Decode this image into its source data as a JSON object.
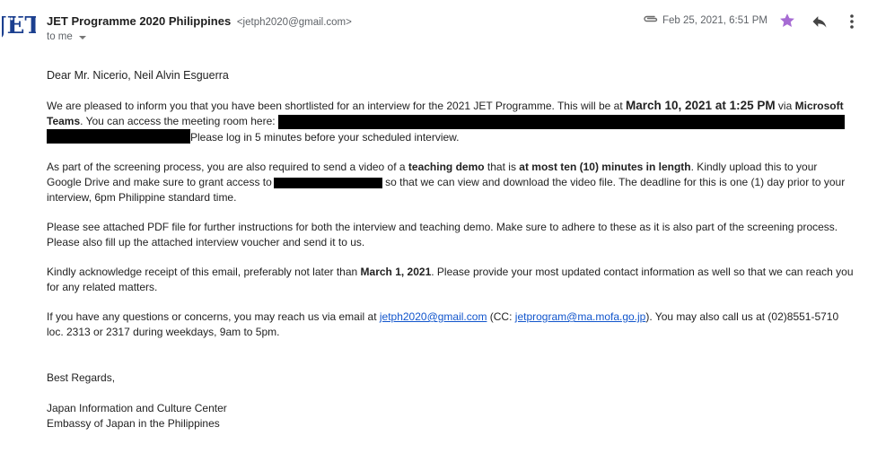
{
  "header": {
    "sender_name": "JET Programme 2020 Philippines",
    "sender_email": "<jetph2020@gmail.com>",
    "to_label": "to me",
    "date": "Feb 25, 2021, 6:51 PM",
    "avatar_text": "JET"
  },
  "icons": {
    "attachment": "paperclip-icon",
    "star": "star-icon",
    "reply": "reply-icon",
    "more": "more-vert-icon"
  },
  "colors": {
    "star": "#a66bd3",
    "link": "#1155cc"
  },
  "body": {
    "greeting": "Dear Mr. Nicerio, Neil Alvin Esguerra",
    "p1": {
      "t1": "We are pleased to inform you that you have been shortlisted for an interview for the 2021 JET Programme. This will be at ",
      "b1": "March 10, 2021 at 1:25 PM",
      "t2": " via ",
      "b2": "Microsoft Teams",
      "t3": ". You can access the meeting room here: ",
      "t4": "Please log in 5 minutes before your scheduled interview."
    },
    "p2": {
      "t1": "As part of the screening process, you are also required to send a video of a ",
      "b1": "teaching demo",
      "t2": " that is ",
      "b2": "at most ten (10) minutes in length",
      "t3": ". Kindly upload this to your Google Drive and make sure to grant access to",
      "t4": " so that we can view and download the video file. The deadline for this is one (1) day prior to your interview, 6pm Philippine standard time."
    },
    "p3": "Please see attached PDF file for further instructions for both the interview and teaching demo. Make sure to adhere to these as it is also part of the screening process. Please also fill up the attached interview voucher and send it to us.",
    "p4": {
      "t1": "Kindly acknowledge receipt of this email, preferably not later than ",
      "b1": "March 1, 2021",
      "t2": ". Please provide your most updated contact information as well so that we can reach you for any related matters."
    },
    "p5": {
      "t1": "If you have any questions or concerns, you may reach us via email at ",
      "link1": "jetph2020@gmail.com",
      "t2": " (CC: ",
      "link2": "jetprogram@ma.mofa.go.jp",
      "t3": "). You may also call us at (02)8551-5710 loc. 2313 or 2317 during weekdays, 9am to 5pm."
    },
    "signoff": "Best Regards,",
    "sig1": "Japan Information and Culture Center",
    "sig2": "Embassy of Japan in the Philippines"
  }
}
